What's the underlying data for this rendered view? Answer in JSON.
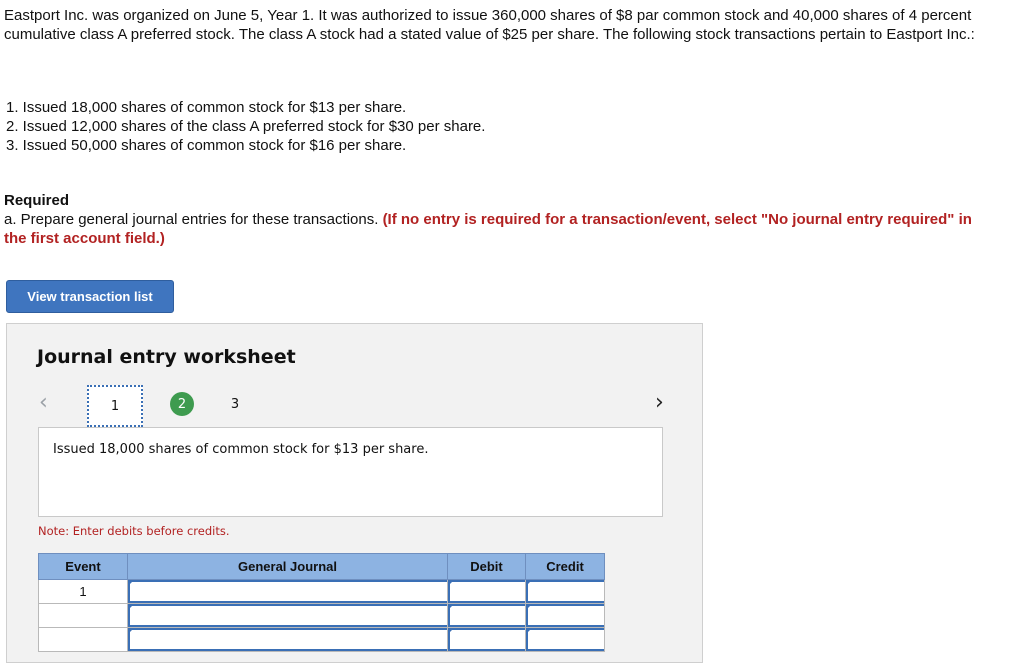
{
  "problem": {
    "intro": "Eastport Inc. was organized on June 5, Year 1. It was authorized to issue 360,000 shares of $8 par common stock and 40,000 shares of 4 percent cumulative class A preferred stock. The class A stock had a stated value of $25 per share. The following stock transactions pertain to Eastport Inc.:",
    "transactions": [
      "1. Issued 18,000 shares of common stock for $13 per share.",
      "2. Issued 12,000 shares of the class A preferred stock for $30 per share.",
      "3. Issued 50,000 shares of common stock for $16 per share."
    ],
    "required_heading": "Required",
    "required_part": "a. Prepare general journal entries for these transactions.",
    "required_instruction": "(If no entry is required for a transaction/event, select \"No journal entry required\" in the first account field.)"
  },
  "buttons": {
    "view_transaction_list": "View transaction list"
  },
  "worksheet": {
    "title": "Journal entry worksheet",
    "steps": [
      "1",
      "2",
      "3"
    ],
    "active_step": "1",
    "description": "Issued 18,000 shares of common stock for $13 per share.",
    "note": "Note: Enter debits before credits.",
    "table": {
      "headers": [
        "Event",
        "General Journal",
        "Debit",
        "Credit"
      ],
      "rows": [
        {
          "event": "1",
          "general_journal": "",
          "debit": "",
          "credit": ""
        },
        {
          "event": "",
          "general_journal": "",
          "debit": "",
          "credit": ""
        },
        {
          "event": "",
          "general_journal": "",
          "debit": "",
          "credit": ""
        }
      ]
    }
  },
  "icons": {
    "prev": "chevron-left-icon",
    "next": "chevron-right-icon"
  },
  "colors": {
    "button": "#3f75bf",
    "header": "#8db3e2",
    "instruction": "#b22222",
    "completed_step": "#3e9b4f"
  }
}
